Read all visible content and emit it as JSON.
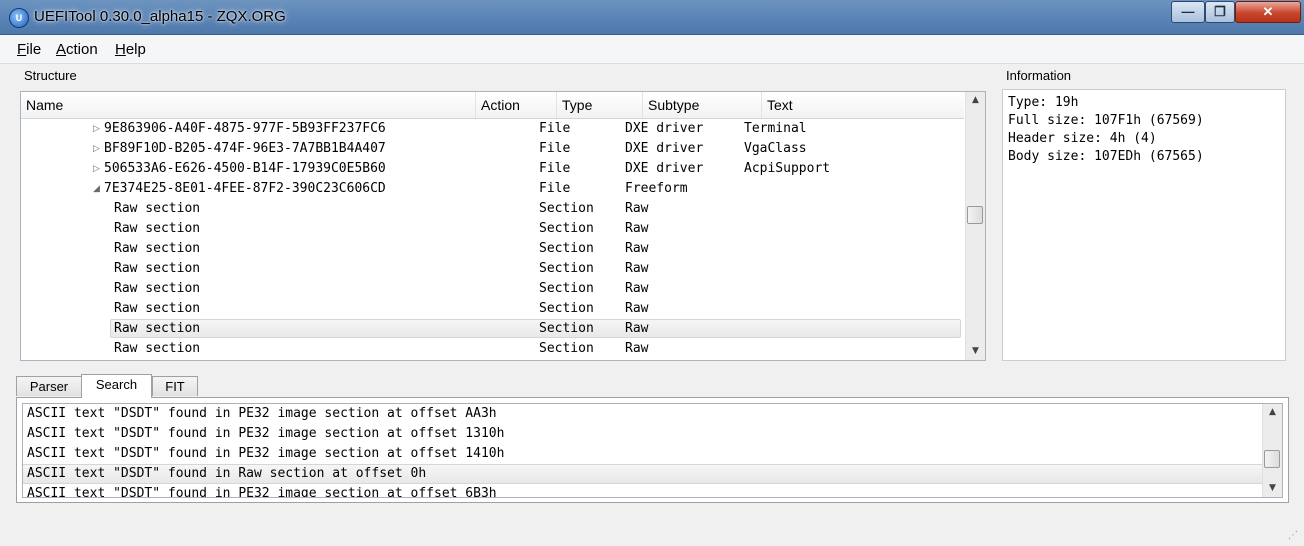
{
  "window": {
    "title": "UEFITool 0.30.0_alpha15 - ZQX.ORG",
    "icon": "app-logo-icon",
    "controls": {
      "minimize": "—",
      "maximize": "❐",
      "close": "✕"
    }
  },
  "menu": [
    {
      "label": "File",
      "accel": "F",
      "rest": "ile"
    },
    {
      "label": "Action",
      "accel": "A",
      "rest": "ction"
    },
    {
      "label": "Help",
      "accel": "H",
      "rest": "elp"
    }
  ],
  "structure": {
    "label": "Structure",
    "columns": [
      "Name",
      "Action",
      "Type",
      "Subtype",
      "Text"
    ],
    "rows": [
      {
        "name": "9E863906-A40F-4875-977F-5B93FF237FC6",
        "expander": "▷",
        "action": "",
        "type": "File",
        "subtype": "DXE driver",
        "text": "Terminal",
        "level": 1,
        "selected": false
      },
      {
        "name": "BF89F10D-B205-474F-96E3-7A7BB1B4A407",
        "expander": "▷",
        "action": "",
        "type": "File",
        "subtype": "DXE driver",
        "text": "VgaClass",
        "level": 1,
        "selected": false
      },
      {
        "name": "506533A6-E626-4500-B14F-17939C0E5B60",
        "expander": "▷",
        "action": "",
        "type": "File",
        "subtype": "DXE driver",
        "text": "AcpiSupport",
        "level": 1,
        "selected": false
      },
      {
        "name": "7E374E25-8E01-4FEE-87F2-390C23C606CD",
        "expander": "◢",
        "action": "",
        "type": "File",
        "subtype": "Freeform",
        "text": "",
        "level": 1,
        "selected": false
      },
      {
        "name": "Raw section",
        "expander": "",
        "action": "",
        "type": "Section",
        "subtype": "Raw",
        "text": "",
        "level": 2,
        "selected": false
      },
      {
        "name": "Raw section",
        "expander": "",
        "action": "",
        "type": "Section",
        "subtype": "Raw",
        "text": "",
        "level": 2,
        "selected": false
      },
      {
        "name": "Raw section",
        "expander": "",
        "action": "",
        "type": "Section",
        "subtype": "Raw",
        "text": "",
        "level": 2,
        "selected": false
      },
      {
        "name": "Raw section",
        "expander": "",
        "action": "",
        "type": "Section",
        "subtype": "Raw",
        "text": "",
        "level": 2,
        "selected": false
      },
      {
        "name": "Raw section",
        "expander": "",
        "action": "",
        "type": "Section",
        "subtype": "Raw",
        "text": "",
        "level": 2,
        "selected": false
      },
      {
        "name": "Raw section",
        "expander": "",
        "action": "",
        "type": "Section",
        "subtype": "Raw",
        "text": "",
        "level": 2,
        "selected": false
      },
      {
        "name": "Raw section",
        "expander": "",
        "action": "",
        "type": "Section",
        "subtype": "Raw",
        "text": "",
        "level": 2,
        "selected": true
      },
      {
        "name": "Raw section",
        "expander": "",
        "action": "",
        "type": "Section",
        "subtype": "Raw",
        "text": "",
        "level": 2,
        "selected": false
      }
    ],
    "scroll_position": 0.45
  },
  "information": {
    "label": "Information",
    "lines": [
      "Type: 19h",
      "Full size: 107F1h (67569)",
      "Header size: 4h (4)",
      "Body size: 107EDh (67565)"
    ]
  },
  "tabs": [
    {
      "label": "Parser",
      "active": false
    },
    {
      "label": "Search",
      "active": true
    },
    {
      "label": "FIT",
      "active": false
    }
  ],
  "search_results": {
    "rows": [
      {
        "text": "ASCII text \"DSDT\" found in PE32 image section at offset AA3h",
        "selected": false
      },
      {
        "text": "ASCII text \"DSDT\" found in PE32 image section at offset 1310h",
        "selected": false
      },
      {
        "text": "ASCII text \"DSDT\" found in PE32 image section at offset 1410h",
        "selected": false
      },
      {
        "text": "ASCII text \"DSDT\" found in Raw section at offset 0h",
        "selected": true
      },
      {
        "text": "ASCII text \"DSDT\" found in PE32 image section at offset 6B3h",
        "selected": false
      }
    ],
    "scroll_position": 0.7
  },
  "icons": {
    "scroll_up": "▲",
    "scroll_down": "▼",
    "resize_grip": "⋰"
  }
}
